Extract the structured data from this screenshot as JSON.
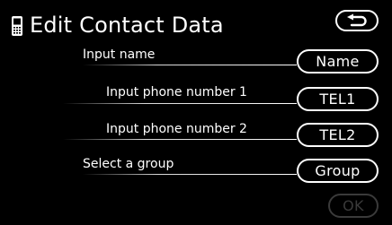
{
  "header": {
    "title": "Edit Contact Data",
    "phone_icon": "mobile-phone-icon",
    "back_icon": "u-turn-back-arrow-icon"
  },
  "rows": [
    {
      "label": "Input name",
      "button": "Name"
    },
    {
      "label": "Input phone number 1",
      "button": "TEL1"
    },
    {
      "label": "Input phone number 2",
      "button": "TEL2"
    },
    {
      "label": "Select a group",
      "button": "Group"
    }
  ],
  "footer": {
    "ok_label": "OK",
    "ok_enabled": false
  },
  "colors": {
    "background": "#000000",
    "text": "#ffffff",
    "disabled": "#3a3a3a"
  }
}
